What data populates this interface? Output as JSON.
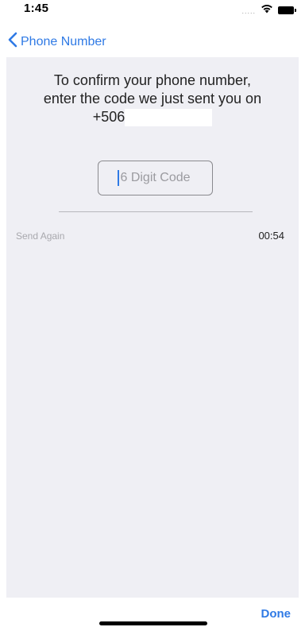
{
  "status_bar": {
    "time": "1:45",
    "signal_dots": ".....",
    "wifi_icon": "wifi-icon",
    "battery_icon": "battery-icon"
  },
  "nav": {
    "back_label": "Phone Number",
    "back_icon": "chevron-left-icon"
  },
  "instruction": {
    "line1": "To confirm your phone number,",
    "line2": "enter the code we just sent you on",
    "phone_prefix": "+506"
  },
  "code_input": {
    "placeholder": "6 Digit Code",
    "value": ""
  },
  "resend": {
    "label": "Send Again",
    "timer": "00:54"
  },
  "toolbar": {
    "done_label": "Done"
  },
  "colors": {
    "accent": "#2f7ae5",
    "panel_bg": "#efeff4"
  }
}
